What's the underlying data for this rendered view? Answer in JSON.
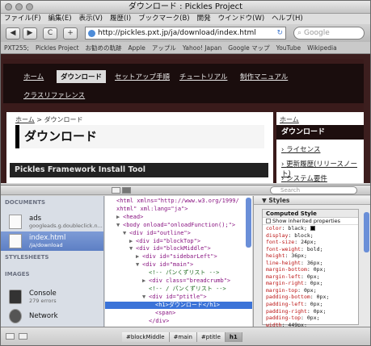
{
  "window": {
    "title": "ダウンロード : Pickles Project"
  },
  "menu": [
    "ファイル(F)",
    "編集(E)",
    "表示(V)",
    "履歴(I)",
    "ブックマーク(B)",
    "開発",
    "ウインドウ(W)",
    "ヘルプ(H)"
  ],
  "toolbar": {
    "back": "◀",
    "forward": "▶",
    "reload": "C",
    "add": "+",
    "url": "http://pickles.pxt.jp/ja/download/index.html",
    "search_placeholder": "Google"
  },
  "bookmarks": [
    "PXT255;",
    "Pickles Project",
    "お勧めの軌跡",
    "Apple",
    "アップル",
    "Yahoo! Japan",
    "Google マップ",
    "YouTube",
    "Wikipedia"
  ],
  "site": {
    "nav": [
      "ホーム",
      "ダウンロード",
      "セットアップ手順",
      "チュートリアル",
      "制作マニュアル",
      "クラスリファレンス"
    ],
    "breadcrumb_home": "ホーム",
    "breadcrumb_sep": " > ",
    "breadcrumb_current": "ダウンロード",
    "heading": "ダウンロード",
    "section_title": "Pickles Framework Install Tool",
    "side_crumb_home": "ホーム",
    "side_heading": "ダウンロード",
    "side_links": [
      "ライセンス",
      "更新履歴(リリースノート)",
      "システム要件"
    ]
  },
  "inspector": {
    "search_placeholder": "Search",
    "sections": {
      "documents": "DOCUMENTS",
      "stylesheets": "STYLESHEETS",
      "images": "IMAGES"
    },
    "resources": [
      {
        "name": "ads",
        "sub": "googleads.g.doubleclick.n..."
      },
      {
        "name": "index.html",
        "sub": "/ja/download"
      }
    ],
    "console": {
      "name": "Console",
      "sub": "279 errors"
    },
    "network": {
      "name": "Network"
    },
    "dom": [
      {
        "indent": 0,
        "tri": "",
        "text": "<html xmlns=\"http://www.w3.org/1999/"
      },
      {
        "indent": 0,
        "tri": "",
        "text": "xhtml\" xml:lang=\"ja\">"
      },
      {
        "indent": 1,
        "tri": "▶",
        "text": "<head>"
      },
      {
        "indent": 1,
        "tri": "▼",
        "text": "<body onload=\"onloadFunction();\">"
      },
      {
        "indent": 2,
        "tri": "▼",
        "text": "<div id=\"outline\">"
      },
      {
        "indent": 3,
        "tri": "▶",
        "text": "<div id=\"blockTop\">"
      },
      {
        "indent": 3,
        "tri": "▼",
        "text": "<div id=\"blockMiddle\">"
      },
      {
        "indent": 4,
        "tri": "▶",
        "text": "<div id=\"sidebarLeft\">"
      },
      {
        "indent": 4,
        "tri": "▼",
        "text": "<div id=\"main\">"
      },
      {
        "indent": 5,
        "tri": "",
        "text": "<!-- パンくずリスト -->"
      },
      {
        "indent": 5,
        "tri": "▶",
        "text": "<div class=\"breadcrumb\">"
      },
      {
        "indent": 5,
        "tri": "",
        "text": "<!-- / パンくずリスト -->"
      },
      {
        "indent": 5,
        "tri": "▼",
        "text": "<div id=\"ptitle\">"
      },
      {
        "indent": 6,
        "tri": "",
        "text": "<h1>ダウンロード</h1>"
      },
      {
        "indent": 6,
        "tri": "",
        "text": "<span>"
      },
      {
        "indent": 5,
        "tri": "",
        "text": "</div>"
      }
    ],
    "selected_dom_index": 13,
    "styles_title": "Styles",
    "computed_title": "Computed Style",
    "show_inherited": "Show inherited properties",
    "computed": [
      {
        "name": "color",
        "value": "black;",
        "swatch": true
      },
      {
        "name": "display",
        "value": "block;"
      },
      {
        "name": "font-size",
        "value": "24px;"
      },
      {
        "name": "font-weight",
        "value": "bold;"
      },
      {
        "name": "height",
        "value": "36px;"
      },
      {
        "name": "line-height",
        "value": "36px;"
      },
      {
        "name": "margin-bottom",
        "value": "0px;"
      },
      {
        "name": "margin-left",
        "value": "0px;"
      },
      {
        "name": "margin-right",
        "value": "0px;"
      },
      {
        "name": "margin-top",
        "value": "0px;"
      },
      {
        "name": "padding-bottom",
        "value": "0px;"
      },
      {
        "name": "padding-left",
        "value": "0px;"
      },
      {
        "name": "padding-right",
        "value": "0px;"
      },
      {
        "name": "padding-top",
        "value": "0px;"
      },
      {
        "name": "width",
        "value": "449px;"
      }
    ],
    "crumbs": [
      "#blockMiddle",
      "#main",
      "#ptitle",
      "h1"
    ]
  }
}
